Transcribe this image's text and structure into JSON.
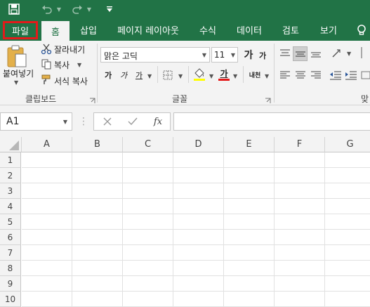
{
  "qat": {
    "icons": [
      "save-icon",
      "undo-icon",
      "redo-icon",
      "customize-qat-icon"
    ]
  },
  "tabs": [
    {
      "label": "파일"
    },
    {
      "label": "홈"
    },
    {
      "label": "삽입"
    },
    {
      "label": "페이지 레이아웃"
    },
    {
      "label": "수식"
    },
    {
      "label": "데이터"
    },
    {
      "label": "검토"
    },
    {
      "label": "보기"
    }
  ],
  "clipboard": {
    "paste_label": "붙여넣기",
    "cut_label": "잘라내기",
    "copy_label": "복사",
    "format_painter_label": "서식 복사",
    "group_label": "클립보드"
  },
  "font": {
    "font_name": "맑은 고딕",
    "font_size": "11",
    "grow_glyph": "가",
    "shrink_glyph": "가",
    "bold_glyph": "가",
    "italic_glyph": "가",
    "underline_glyph": "가",
    "font_color_glyph": "가",
    "phonetic_glyph": "내천",
    "group_label": "글꼴",
    "fill_color": "#ffff00",
    "text_color": "#e31b1b"
  },
  "alignment": {
    "group_label_partial": "맞"
  },
  "formula_bar": {
    "name_box": "A1",
    "fx_label": "fx",
    "value": ""
  },
  "sheet": {
    "columns": [
      "A",
      "B",
      "C",
      "D",
      "E",
      "F",
      "G"
    ],
    "rows": [
      "1",
      "2",
      "3",
      "4",
      "5",
      "6",
      "7",
      "8",
      "9",
      "10"
    ]
  },
  "colors": {
    "brand": "#217346",
    "highlight": "#e31b1b"
  }
}
